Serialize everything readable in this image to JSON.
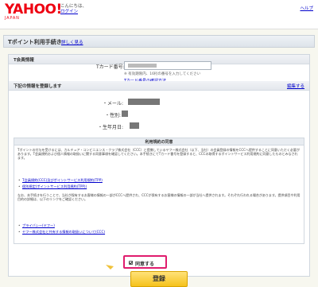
{
  "header": {
    "logo_text": "YAHOO!",
    "logo_sub": "JAPAN",
    "greeting": "こんにちは、",
    "login_link": "ログイン",
    "help_link": "ヘルプ"
  },
  "page": {
    "title": "Tポイント利用手続き",
    "detail_link": "詳しく見る"
  },
  "tcard_section": {
    "heading": "T会員情報",
    "card_number_label": "Tカード番号:",
    "card_number_note": "※ 有効期限内、16桁の番号を入力してください",
    "card_number_link": "Tカード番号の確認方法"
  },
  "register_section": {
    "heading": "下記の情報を登録します",
    "edit_link": "編集する",
    "email_label": "・メール:",
    "gender_label": "・性別:",
    "birthday_label": "・生年月日:"
  },
  "agreement": {
    "heading": "利用規約の同意",
    "para1": "Tポイントの付与を受けるには、カルチュア・コンビニエンス・クラブ株式会社（CCC）と提携しているヤフー株式会社（以下、当社）の会員登録の情報をCCCへ提供することに同意いただく必要があります。T会員規約および個人情報の取扱いに関する同意事項を確認してください。本手続きにてTカード番号を登録すると、CCCの取得するポイントサービス利用規約に同意したものとみなされます。",
    "link1": "T会員規約(CCC)及びポイントサービス利用規約(TPP)",
    "link2": "個別規定(ポイントサービス利用規約(TPP))",
    "para2": "なお、本手続きを行うことで、当社が保有するお客様の情報の一部がCCCへ提供され、CCCが保有するお客様の情報の一部が当社へ提供されます。それぞれ行われる場合があります。提供項目や利用目的の詳細は、以下のリンクをご確認ください。",
    "link3": "プライバシー(ヤフー)",
    "link4": "ヤフー株式会社と共有する情報の取扱いについて(CCC)",
    "consent_label": "同意する"
  },
  "actions": {
    "submit_label": "登録"
  },
  "colors": {
    "accent_red": "#e01c6d",
    "button_yellow": "#f5c21b",
    "link_blue": "#0000cc"
  }
}
